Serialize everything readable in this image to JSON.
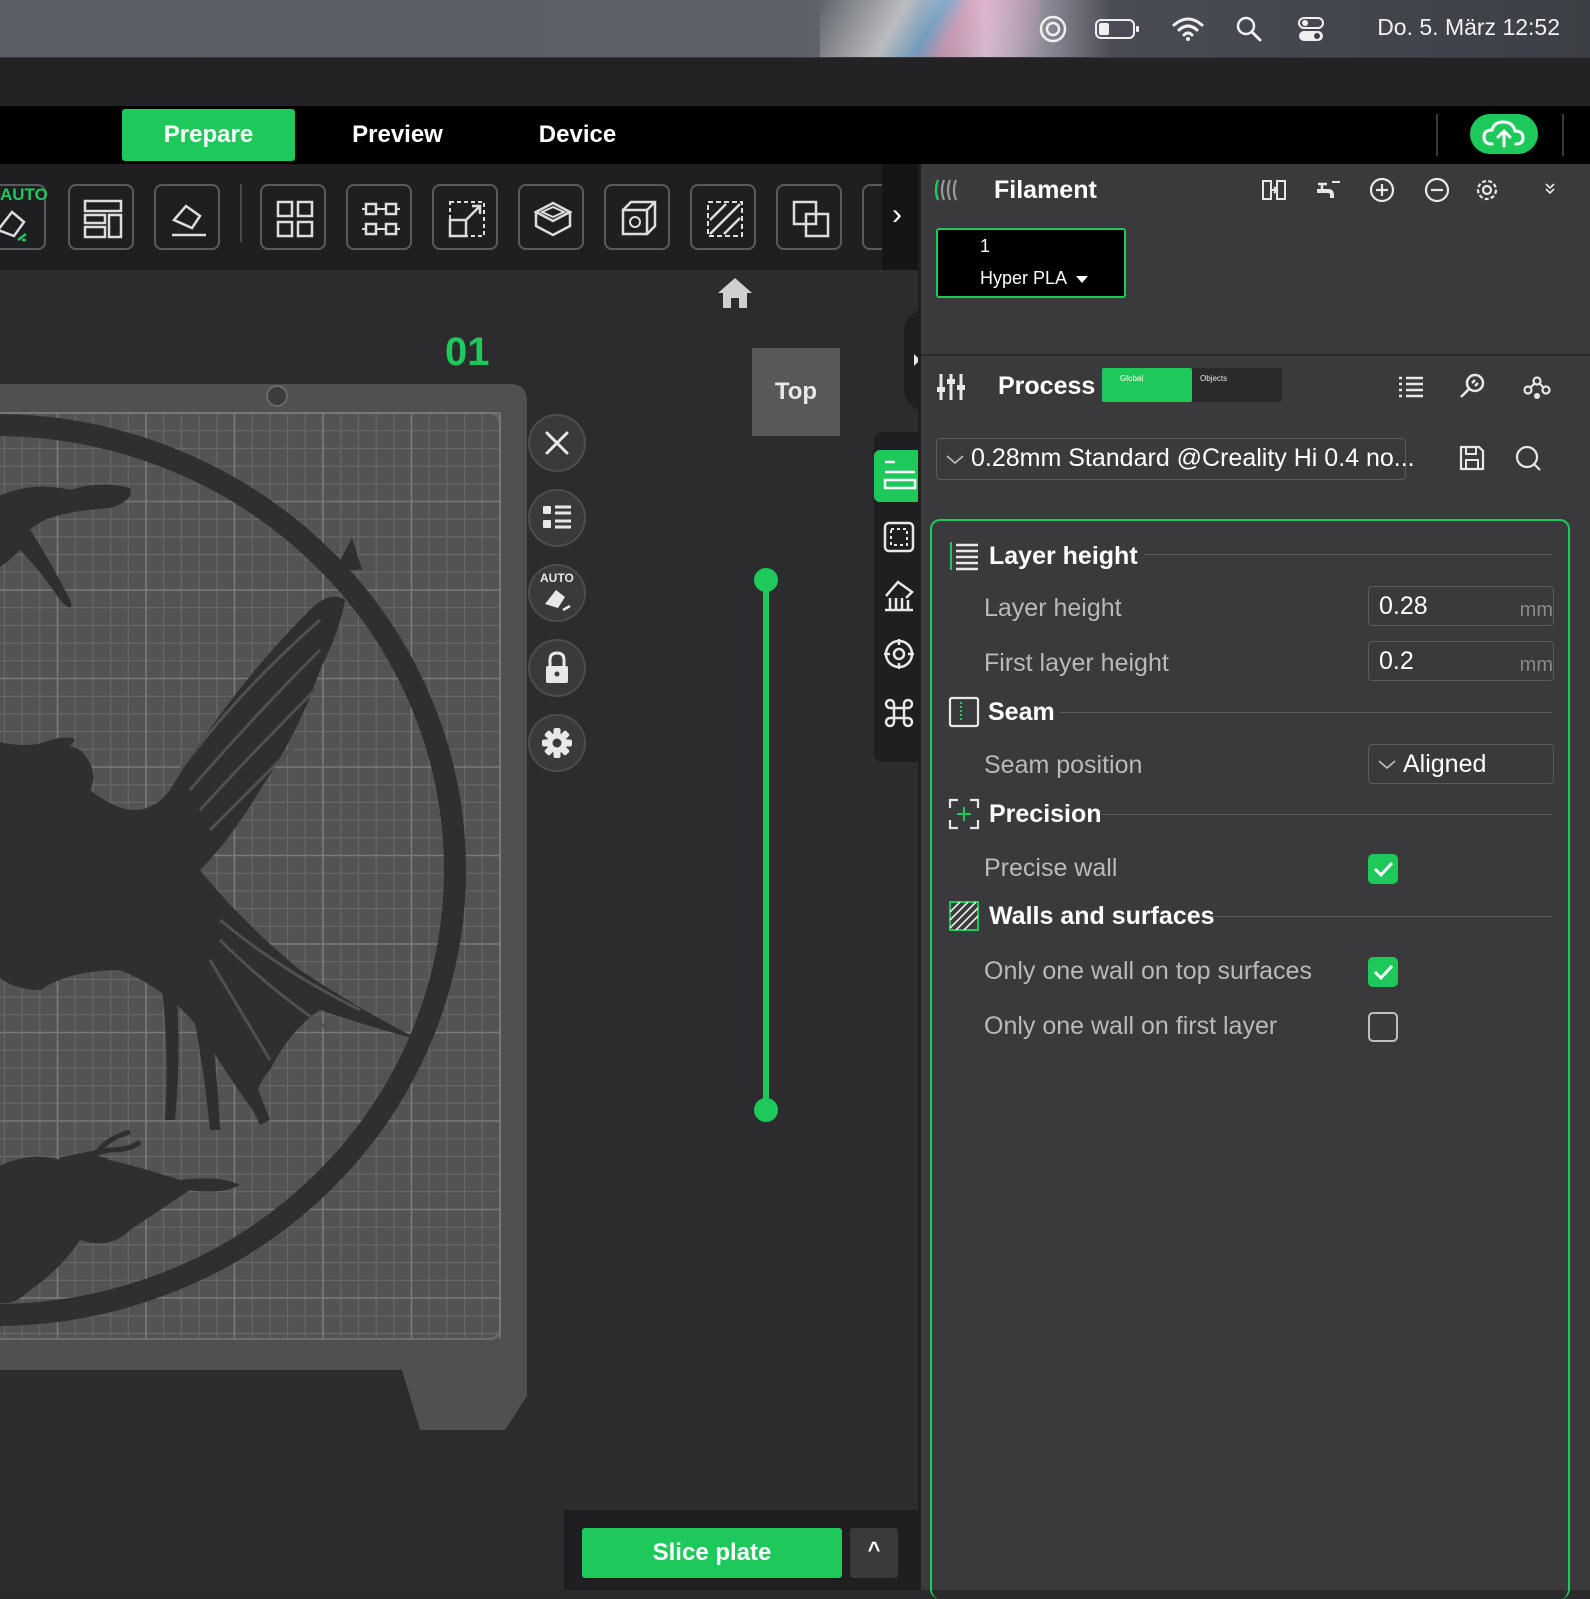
{
  "menubar": {
    "datetime": "Do. 5. März  12:52",
    "icons": [
      "screen-mirror-icon",
      "battery-icon",
      "wifi-icon",
      "spotlight-search-icon",
      "control-center-icon"
    ]
  },
  "tabs": {
    "prepare": "Prepare",
    "preview": "Preview",
    "device": "Device"
  },
  "toolbar": {
    "auto_label": "AUTO",
    "expand_glyph": "›"
  },
  "viewport": {
    "plate_number": "01",
    "view_label": "Top",
    "auto_badge": "AUTO"
  },
  "slice": {
    "button_label": "Slice plate",
    "expand_glyph": "^"
  },
  "filament": {
    "title": "Filament",
    "slot_number": "1",
    "slot_name": "Hyper PLA"
  },
  "process": {
    "title": "Process",
    "toggle_global": "Global",
    "toggle_objects": "Objects",
    "preset": "0.28mm Standard @Creality Hi 0.4 no..."
  },
  "settings": {
    "layer_height_group": "Layer height",
    "layer_height_label": "Layer height",
    "layer_height_value": "0.28",
    "first_layer_height_label": "First layer height",
    "first_layer_height_value": "0.2",
    "unit": "mm",
    "seam_group": "Seam",
    "seam_position_label": "Seam position",
    "seam_position_value": "Aligned",
    "precision_group": "Precision",
    "precise_wall_label": "Precise wall",
    "precise_wall": true,
    "walls_group": "Walls and surfaces",
    "one_wall_top_label": "Only one wall on top surfaces",
    "one_wall_top": true,
    "one_wall_first_label": "Only one wall on first layer",
    "one_wall_first": false
  },
  "colors": {
    "accent": "#1ec95b",
    "panel": "#3a3a3c",
    "toolbar": "#1f1f21",
    "viewport": "#2c2c2e"
  }
}
